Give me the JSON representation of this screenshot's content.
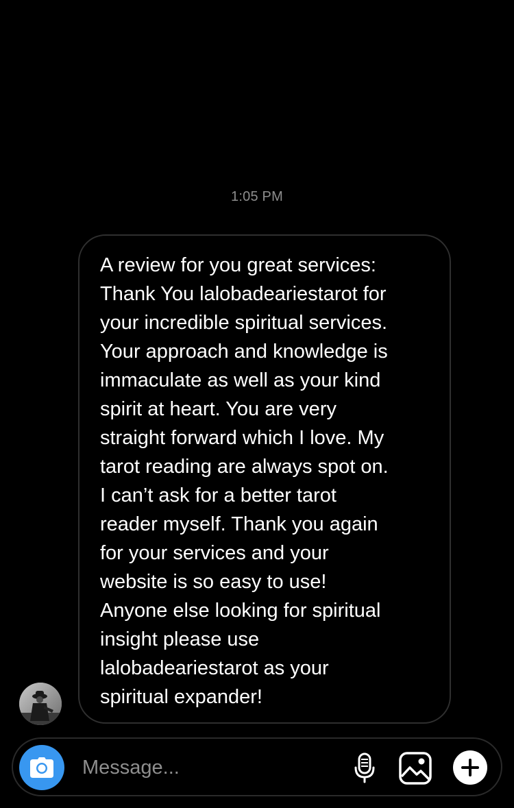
{
  "conversation": {
    "timestamp": "1:05 PM",
    "messages": [
      {
        "text": "A review for you great services:\nThank You lalobadeariestarot for\nyour incredible spiritual services.\nYour approach and knowledge is\nimmaculate as well as your kind\nspirit at heart. You are very\nstraight forward which I love. My\ntarot reading are always spot on.\nI can’t ask for a better tarot\nreader myself. Thank you again\nfor your services and your\nwebsite is so easy to use!\nAnyone else looking for spiritual\ninsight please use\nlalobadeariestarot as your\nspiritual expander!"
      }
    ]
  },
  "composer": {
    "placeholder": "Message...",
    "value": "",
    "icons": {
      "camera": "camera-icon",
      "microphone": "microphone-icon",
      "gallery": "gallery-icon",
      "plus": "plus-icon"
    }
  },
  "colors": {
    "background": "#000000",
    "accent": "#3897f0",
    "muted_text": "#8e8e8e",
    "bubble_border": "#2f2f2f"
  }
}
